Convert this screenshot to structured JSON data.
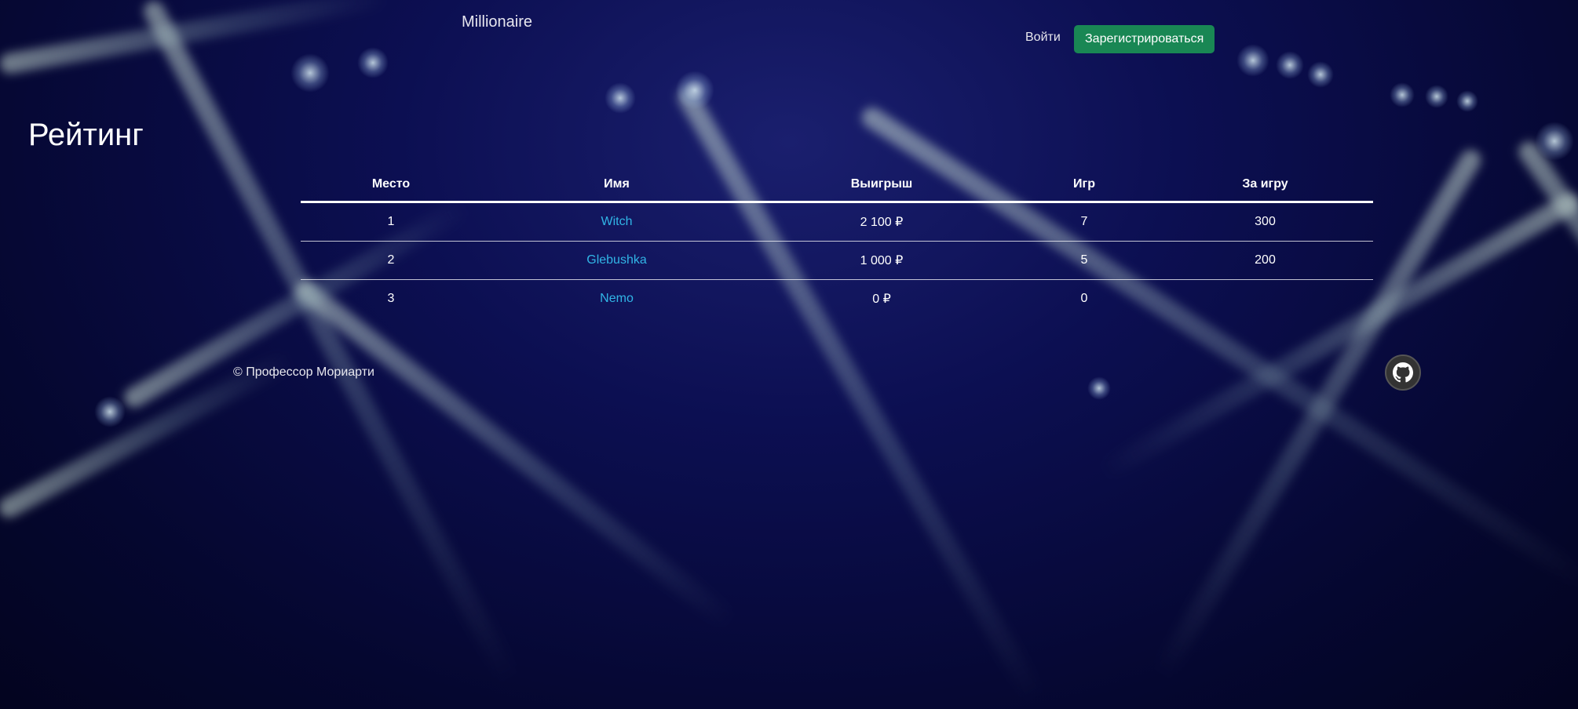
{
  "header": {
    "brand": "Millionaire",
    "login_label": "Войти",
    "signup_label": "Зарегистрироваться"
  },
  "page": {
    "title": "Рейтинг"
  },
  "table": {
    "columns": [
      "Место",
      "Имя",
      "Выигрыш",
      "Игр",
      "За игру"
    ],
    "rows": [
      {
        "place": "1",
        "name": "Witch",
        "winnings": "2 100 ₽",
        "games": "7",
        "per_game": "300"
      },
      {
        "place": "2",
        "name": "Glebushka",
        "winnings": "1 000 ₽",
        "games": "5",
        "per_game": "200"
      },
      {
        "place": "3",
        "name": "Nemo",
        "winnings": "0 ₽",
        "games": "0",
        "per_game": ""
      }
    ]
  },
  "footer": {
    "copyright": "© Профессор Мориарти",
    "github_icon": "github-icon"
  },
  "colors": {
    "accent_link": "#31b5e6",
    "signup_button": "#198754",
    "background": "#07093a"
  }
}
